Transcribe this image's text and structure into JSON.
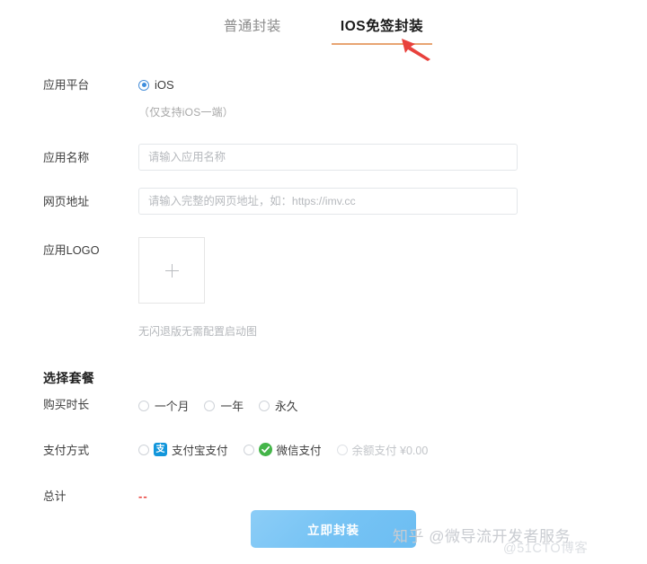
{
  "tabs": [
    {
      "label": "普通封装",
      "active": false
    },
    {
      "label": "IOS免签封装",
      "active": true
    }
  ],
  "annotation": {
    "arrow_color": "#e8413c",
    "name": "red-arrow-pointing-at-active-tab"
  },
  "form": {
    "platform": {
      "label": "应用平台",
      "option_label": "iOS",
      "selected": true,
      "hint": "（仅支持iOS一端）"
    },
    "app_name": {
      "label": "应用名称",
      "placeholder": "请输入应用名称",
      "value": ""
    },
    "web_url": {
      "label": "网页地址",
      "placeholder": "请输入完整的网页地址，如：https://imv.cc",
      "value": ""
    },
    "logo": {
      "label": "应用LOGO",
      "upload_glyph": "plus-icon",
      "note": "无闪退版无需配置启动图"
    }
  },
  "package": {
    "title": "选择套餐",
    "duration": {
      "label": "购买时长",
      "options": [
        {
          "label": "一个月",
          "selected": false
        },
        {
          "label": "一年",
          "selected": false
        },
        {
          "label": "永久",
          "selected": false
        }
      ]
    },
    "payment": {
      "label": "支付方式",
      "options": [
        {
          "label": "支付宝支付",
          "icon": "alipay-icon",
          "selected": false,
          "disabled": false
        },
        {
          "label": "微信支付",
          "icon": "wechat-icon",
          "selected": false,
          "disabled": false
        },
        {
          "label": "余额支付 ¥0.00",
          "icon": "none",
          "selected": false,
          "disabled": true
        }
      ]
    },
    "total": {
      "label": "总计",
      "value": "--",
      "color": "#e8413c"
    }
  },
  "submit": {
    "label": "立即封装"
  },
  "watermarks": {
    "zhihu": "知乎 @微导流开发者服务",
    "cto": "@51CTO博客"
  },
  "colors": {
    "accent_tab_underline": "#e8a572",
    "radio_checked": "#3d8ddd",
    "alipay": "#1296db",
    "wechat": "#44b549",
    "submit_gradient_start": "#8ccdf7",
    "submit_gradient_end": "#6cbdf2"
  }
}
